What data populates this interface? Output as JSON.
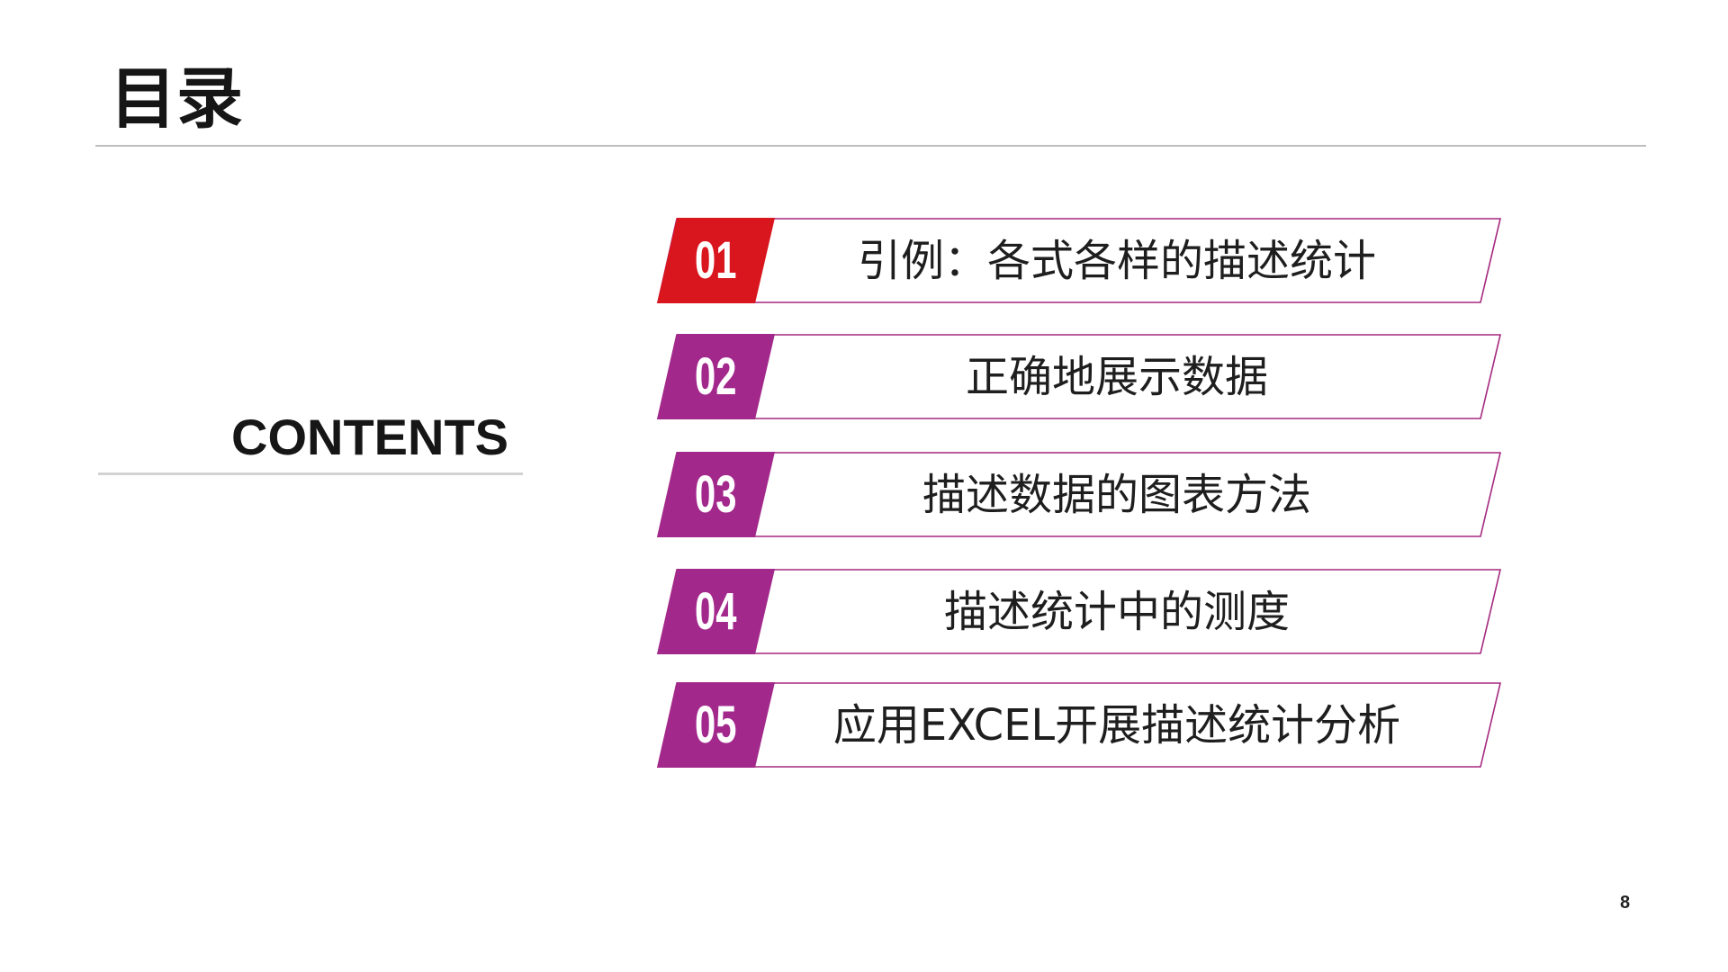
{
  "title": "目录",
  "contents_label": "CONTENTS",
  "page_number": "8",
  "colors": {
    "accent_red": "#d9151e",
    "accent_purple": "#a2288c",
    "outline": "#a5297f",
    "text": "#1e1e1e",
    "rule": "#bdbdbd"
  },
  "toc": [
    {
      "number": "01",
      "label": "引例：各式各样的描述统计",
      "badge_color": "#d9151e"
    },
    {
      "number": "02",
      "label": "正确地展示数据",
      "badge_color": "#a2288c"
    },
    {
      "number": "03",
      "label": "描述数据的图表方法",
      "badge_color": "#a2288c"
    },
    {
      "number": "04",
      "label": "描述统计中的测度",
      "badge_color": "#a2288c"
    },
    {
      "number": "05",
      "label": "应用EXCEL开展描述统计分析",
      "badge_color": "#a2288c"
    }
  ]
}
